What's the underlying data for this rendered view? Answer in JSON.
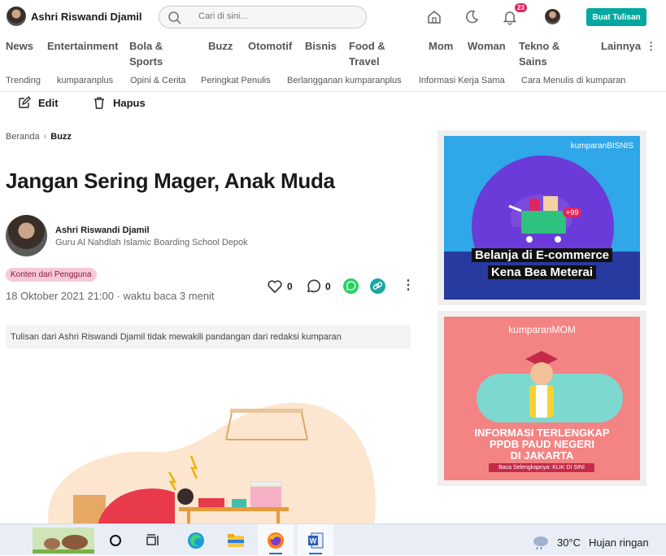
{
  "header": {
    "username": "Ashri Riswandi Djamil",
    "search_placeholder": "Cari di sini...",
    "notifications_count": "23",
    "write_button": "Buat Tulisan"
  },
  "nav": {
    "items": [
      {
        "label": "News"
      },
      {
        "label": "Entertainment"
      },
      {
        "label": "Bola &",
        "label2": "Sports"
      },
      {
        "label": "Buzz"
      },
      {
        "label": "Otomotif"
      },
      {
        "label": "Bisnis"
      },
      {
        "label": "Food &",
        "label2": "Travel"
      },
      {
        "label": "Mom"
      },
      {
        "label": "Woman"
      },
      {
        "label": "Tekno &",
        "label2": "Sains"
      },
      {
        "label": "Lainnya"
      }
    ],
    "sub": [
      "Trending",
      "kumparanplus",
      "Opini & Cerita",
      "Peringkat Penulis",
      "Berlangganan kumparanplus",
      "Informasi Kerja Sama",
      "Cara Menulis di kumparan"
    ]
  },
  "toolbar": {
    "edit": "Edit",
    "delete": "Hapus"
  },
  "breadcrumb": {
    "home": "Beranda",
    "current": "Buzz"
  },
  "article": {
    "title": "Jangan Sering Mager, Anak Muda",
    "author": "Ashri Riswandi Djamil",
    "author_bio": "Guru Al Nahdlah Islamic Boarding School Depok",
    "tag": "Konten dari Pengguna",
    "meta": "18 Oktober 2021 21:00 · waktu baca 3 menit",
    "likes": "0",
    "comments": "0",
    "notice": "Tulisan dari Ashri Riswandi Djamil tidak mewakili pandangan dari redaksi kumparan"
  },
  "ads": {
    "ad1": {
      "brand": "kumparanBISNIS",
      "badge": "+99",
      "line1": "Belanja di E-commerce",
      "line2": "Kena Bea Meterai"
    },
    "ad2": {
      "brand": "kumparanMOM",
      "line1": "INFORMASI TERLENGKAP",
      "line2": "PPDB PAUD NEGERI",
      "line3": "DI JAKARTA",
      "cta": "Baca Selengkapnya: KLIK DI SINI"
    }
  },
  "taskbar": {
    "temperature": "30°C",
    "condition": "Hujan ringan"
  },
  "colors": {
    "accent": "#00a8a0",
    "badge": "#e0245e",
    "tag_bg": "#f7c9d7"
  }
}
